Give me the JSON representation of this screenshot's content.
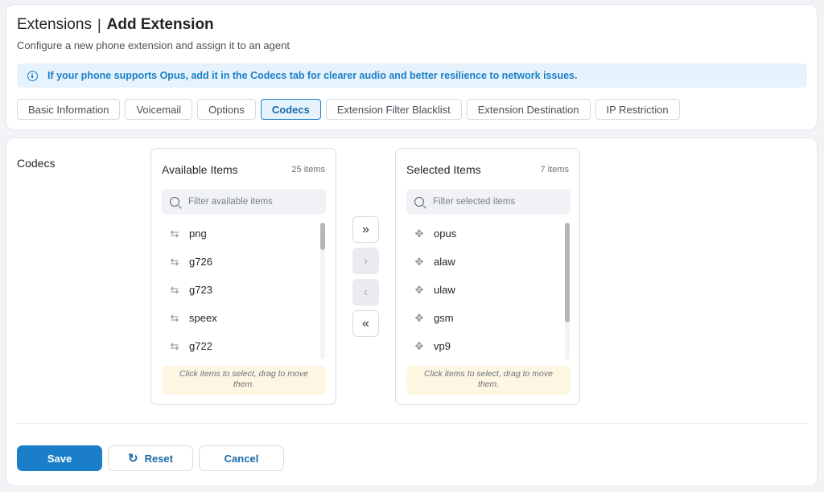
{
  "header": {
    "crumb": "Extensions",
    "separator": "|",
    "page_title": "Add Extension",
    "subtitle": "Configure a new phone extension and assign it to an agent"
  },
  "notice": {
    "icon": "info-icon",
    "text": "If your phone supports Opus, add it in the Codecs tab for clearer audio and better resilience to network issues."
  },
  "tabs": [
    {
      "label": "Basic Information",
      "active": false
    },
    {
      "label": "Voicemail",
      "active": false
    },
    {
      "label": "Options",
      "active": false
    },
    {
      "label": "Codecs",
      "active": true
    },
    {
      "label": "Extension Filter Blacklist",
      "active": false
    },
    {
      "label": "Extension Destination",
      "active": false
    },
    {
      "label": "IP Restriction",
      "active": false
    }
  ],
  "codecs": {
    "label": "Codecs",
    "available": {
      "title": "Available Items",
      "count": "25 items",
      "filter_placeholder": "Filter available items",
      "items": [
        "png",
        "g726",
        "g723",
        "speex",
        "g722"
      ],
      "item_icon": "swap-arrows-icon",
      "hint": "Click items to select, drag to move them."
    },
    "selected": {
      "title": "Selected Items",
      "count": "7 items",
      "filter_placeholder": "Filter selected items",
      "items": [
        "opus",
        "alaw",
        "ulaw",
        "gsm",
        "vp9"
      ],
      "item_icon": "drag-move-icon",
      "hint": "Click items to select, drag to move them."
    },
    "move_buttons": {
      "move_all_right": "»",
      "move_right": "›",
      "move_left": "‹",
      "move_all_left": "«"
    }
  },
  "actions": {
    "save": "Save",
    "reset": "Reset",
    "reset_icon": "↻",
    "cancel": "Cancel"
  },
  "colors": {
    "accent": "#1a7fc8",
    "notice_bg": "#e6f3fd",
    "hint_bg": "#fdf6e3"
  }
}
